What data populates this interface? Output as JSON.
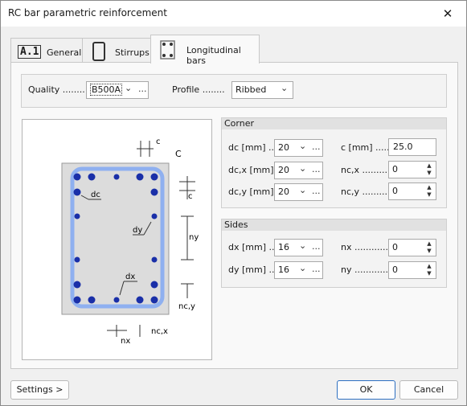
{
  "window": {
    "title": "RC bar parametric reinforcement",
    "close_glyph": "✕"
  },
  "tabs": [
    {
      "label": "General",
      "icon": "A.1"
    },
    {
      "label": "Stirrups",
      "icon": "stirrup-icon"
    },
    {
      "label": "Longitudinal bars",
      "icon": "longitudinal-bars-icon"
    }
  ],
  "quality": {
    "label": "Quality ........",
    "value": "B500A"
  },
  "profile": {
    "label": "Profile ........",
    "value": "Ribbed"
  },
  "corner": {
    "title": "Corner",
    "dc": {
      "label": "dc [mm] ....",
      "value": "20"
    },
    "dcx": {
      "label": "dc,x [mm] ..",
      "value": "20"
    },
    "dcy": {
      "label": "dc,y [mm] ..",
      "value": "20"
    },
    "c": {
      "label": "c [mm] ......",
      "value": "25.0"
    },
    "ncx": {
      "label": "nc,x ..........",
      "value": "0"
    },
    "ncy": {
      "label": "nc,y ..........",
      "value": "0"
    }
  },
  "sides": {
    "title": "Sides",
    "dx": {
      "label": "dx [mm] ....",
      "value": "16"
    },
    "dy": {
      "label": "dy [mm] ....",
      "value": "16"
    },
    "nx": {
      "label": "nx ............",
      "value": "0"
    },
    "ny": {
      "label": "ny ............",
      "value": "0"
    }
  },
  "diagram": {
    "c_top": "c",
    "C": "C",
    "c_right": "c",
    "dc": "dc",
    "dy": "dy",
    "dx": "dx",
    "ny": "ny",
    "ncy": "nc,y",
    "nx": "nx",
    "ncx": "nc,x"
  },
  "buttons": {
    "settings": "Settings >",
    "ok": "OK",
    "cancel": "Cancel"
  },
  "colors": {
    "bar": "#1a2fa8",
    "stirrup": "#8fb0f0",
    "section": "#dcdcdc",
    "accent": "#2d6fc1"
  }
}
